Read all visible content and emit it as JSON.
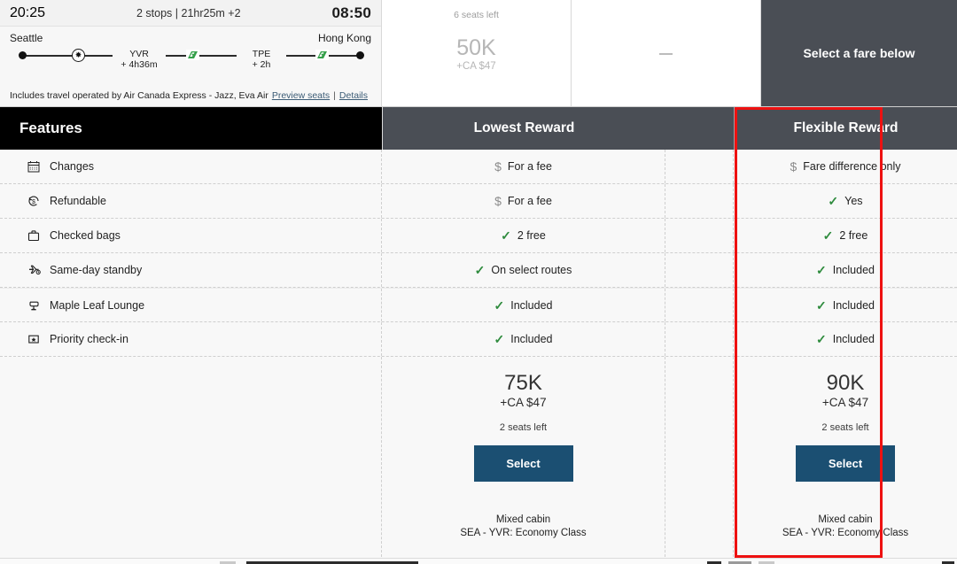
{
  "itinerary": {
    "depart_time": "20:25",
    "arrive_time": "08:50",
    "stops_summary": "2 stops | 21hr25m +2",
    "origin_city": "Seattle",
    "destination_city": "Hong Kong",
    "stops": [
      {
        "code": "YVR",
        "duration": "+ 4h36m"
      },
      {
        "code": "TPE",
        "duration": "+ 2h"
      }
    ],
    "operated_note": "Includes travel operated by Air Canada Express - Jazz, Eva Air",
    "preview_seats_link": "Preview seats",
    "link_separator": "|",
    "details_link": "Details"
  },
  "top_fares": [
    {
      "seats_left": "6 seats left",
      "points": "50K",
      "fee": "+CA $47"
    },
    {
      "dash": "—"
    }
  ],
  "cta": {
    "label": "Select a fare below"
  },
  "table": {
    "features_header": "Features",
    "columns": [
      {
        "label": "Lowest Reward"
      },
      {
        "label": "Flexible Reward"
      }
    ],
    "rows": [
      {
        "icon": "calendar-icon",
        "feature": "Changes",
        "lowest": {
          "mark": "$",
          "text": "For a fee"
        },
        "flexible": {
          "mark": "$",
          "text": "Fare difference only"
        }
      },
      {
        "icon": "refund-dollar-icon",
        "feature": "Refundable",
        "lowest": {
          "mark": "$",
          "text": "For a fee"
        },
        "flexible": {
          "mark": "check",
          "text": "Yes"
        }
      },
      {
        "icon": "suitcase-icon",
        "feature": "Checked bags",
        "lowest": {
          "mark": "check",
          "text": "2 free"
        },
        "flexible": {
          "mark": "check",
          "text": "2 free"
        }
      },
      {
        "icon": "standby-plane-icon",
        "feature": "Same-day standby",
        "lowest": {
          "mark": "check",
          "text": "On select routes"
        },
        "flexible": {
          "mark": "check",
          "text": "Included"
        }
      },
      {
        "icon": "lounge-chair-icon",
        "feature": "Maple Leaf Lounge",
        "lowest": {
          "mark": "check",
          "text": "Included"
        },
        "flexible": {
          "mark": "check",
          "text": "Included"
        }
      },
      {
        "icon": "star-badge-icon",
        "feature": "Priority check-in",
        "lowest": {
          "mark": "check",
          "text": "Included"
        },
        "flexible": {
          "mark": "check",
          "text": "Included"
        }
      }
    ],
    "prices": [
      {
        "points": "75K",
        "fee": "+CA $47",
        "seats_left": "2 seats left",
        "select_label": "Select",
        "cabin_line1": "Mixed cabin",
        "cabin_line2": "SEA - YVR: Economy Class"
      },
      {
        "points": "90K",
        "fee": "+CA $47",
        "seats_left": "2 seats left",
        "select_label": "Select",
        "cabin_line1": "Mixed cabin",
        "cabin_line2": "SEA - YVR: Economy Class"
      }
    ]
  },
  "colors": {
    "header_black": "#000000",
    "header_gray": "#4a4e55",
    "select_blue": "#1b4f72",
    "check_green": "#2e8b3d",
    "highlight_red": "#ee1111",
    "link_blue": "#3b5b75"
  }
}
